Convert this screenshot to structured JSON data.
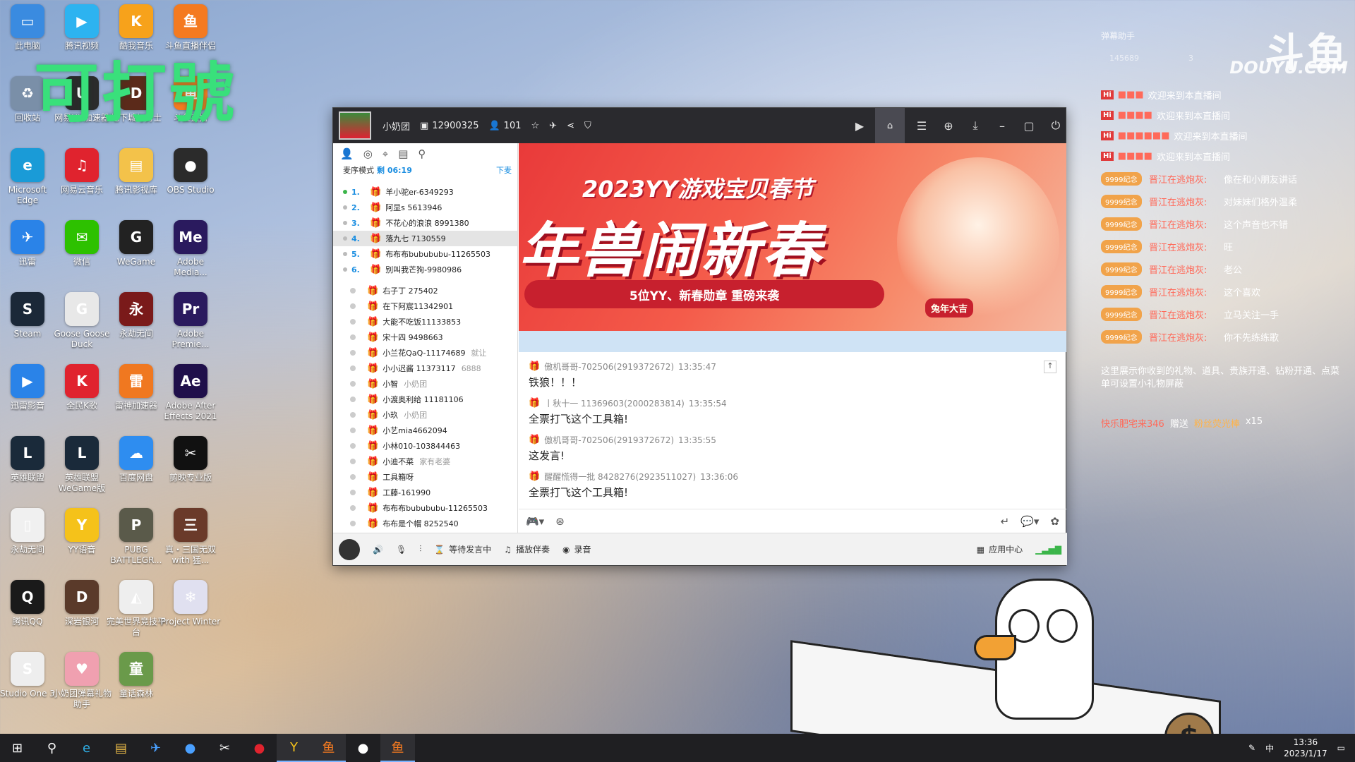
{
  "desktop": {
    "watermark": "可打號",
    "icons": [
      {
        "label": "此电脑",
        "icon": "pc-icon",
        "color": "#3a8be0",
        "char": "▭"
      },
      {
        "label": "腾讯视频",
        "icon": "video-icon",
        "color": "#2db3f0",
        "char": "▶"
      },
      {
        "label": "酷我音乐",
        "icon": "music-icon",
        "color": "#f7a21b",
        "char": "K"
      },
      {
        "label": "斗鱼直播伴侣",
        "icon": "douyu-icon",
        "color": "#f47a20",
        "char": "鱼"
      },
      {
        "label": "回收站",
        "icon": "recycle-bin-icon",
        "color": "#7a8fa8",
        "char": "♻"
      },
      {
        "label": "网易UU加速器",
        "icon": "uu-icon",
        "color": "#2b2b2b",
        "char": "U"
      },
      {
        "label": "地下城与勇士",
        "icon": "dnf-icon",
        "color": "#5b2a1a",
        "char": "D"
      },
      {
        "label": "斗鱼直播",
        "icon": "douyu-live-icon",
        "color": "#f47a20",
        "char": "鱼"
      },
      {
        "label": "Microsoft Edge",
        "icon": "edge-icon",
        "color": "#1a9bd7",
        "char": "e"
      },
      {
        "label": "网易云音乐",
        "icon": "netease-music-icon",
        "color": "#e0232e",
        "char": "♫"
      },
      {
        "label": "腾讯影视库",
        "icon": "folder-icon",
        "color": "#f3c24a",
        "char": "▤"
      },
      {
        "label": "OBS Studio",
        "icon": "obs-icon",
        "color": "#2b2b2b",
        "char": "●"
      },
      {
        "label": "迅雷",
        "icon": "thunder-icon",
        "color": "#2a83e8",
        "char": "✈"
      },
      {
        "label": "微信",
        "icon": "wechat-icon",
        "color": "#2dc100",
        "char": "✉"
      },
      {
        "label": "WeGame",
        "icon": "wegame-icon",
        "color": "#222",
        "char": "G"
      },
      {
        "label": "Adobe Media...",
        "icon": "adobe-me-icon",
        "color": "#2a1a5e",
        "char": "Me"
      },
      {
        "label": "Steam",
        "icon": "steam-icon",
        "color": "#1b2838",
        "char": "S"
      },
      {
        "label": "Goose Goose Duck",
        "icon": "goose-icon",
        "color": "#e8e8e8",
        "char": "G"
      },
      {
        "label": "永劫无间",
        "icon": "naraka-icon",
        "color": "#7a1a1a",
        "char": "永"
      },
      {
        "label": "Adobe Premie...",
        "icon": "adobe-pr-icon",
        "color": "#2a1a5e",
        "char": "Pr"
      },
      {
        "label": "迅雷影音",
        "icon": "xunlei-player-icon",
        "color": "#2a83e8",
        "char": "▶"
      },
      {
        "label": "全民K歌",
        "icon": "kge-icon",
        "color": "#e0232e",
        "char": "K"
      },
      {
        "label": "雷神加速器",
        "icon": "leishen-icon",
        "color": "#f07820",
        "char": "雷"
      },
      {
        "label": "Adobe After Effects 2021",
        "icon": "adobe-ae-icon",
        "color": "#1f0f4a",
        "char": "Ae"
      },
      {
        "label": "英雄联盟",
        "icon": "lol-icon",
        "color": "#1a2a3a",
        "char": "L"
      },
      {
        "label": "英雄联盟WeGame版",
        "icon": "lol-wegame-icon",
        "color": "#1a2a3a",
        "char": "L"
      },
      {
        "label": "百度网盘",
        "icon": "baidu-pan-icon",
        "color": "#2e8df0",
        "char": "☁"
      },
      {
        "label": "剪映专业版",
        "icon": "jianying-icon",
        "color": "#111",
        "char": "✂"
      },
      {
        "label": "永劫无间",
        "icon": "file-icon",
        "color": "#f0f0f0",
        "char": "▯"
      },
      {
        "label": "YY语音",
        "icon": "yy-icon",
        "color": "#f5c21a",
        "char": "Y"
      },
      {
        "label": "PUBG BATTLEGR...",
        "icon": "pubg-icon",
        "color": "#5a5a4a",
        "char": "P"
      },
      {
        "label": "真・三国无双 with 猛...",
        "icon": "sanguo-icon",
        "color": "#6a3a2a",
        "char": "三"
      },
      {
        "label": "腾讯QQ",
        "icon": "qq-icon",
        "color": "#1a1a1a",
        "char": "Q"
      },
      {
        "label": "深岩银河",
        "icon": "deep-rock-icon",
        "color": "#5a3a2a",
        "char": "D"
      },
      {
        "label": "完美世界竞技平台",
        "icon": "perfect-world-icon",
        "color": "#eee",
        "char": "◭"
      },
      {
        "label": "Project Winter",
        "icon": "project-winter-icon",
        "color": "#e0e0f0",
        "char": "❄"
      },
      {
        "label": "Studio One 3",
        "icon": "studio-one-icon",
        "color": "#eee",
        "char": "S"
      },
      {
        "label": "小奶团弹幕礼物助手",
        "icon": "danmu-helper-icon",
        "color": "#f0a0b0",
        "char": "♥"
      },
      {
        "label": "童话森林",
        "icon": "forest-icon",
        "color": "#6a9a4a",
        "char": "童"
      }
    ]
  },
  "window": {
    "channel_name": "小奶团",
    "room_id": "12900325",
    "viewers": "101",
    "left": {
      "mode_label": "麦序模式",
      "time_left": "剩 06:19",
      "down_label": "下麦",
      "queue": [
        {
          "num": "1.",
          "name": "羊小驼er-6349293",
          "active": true
        },
        {
          "num": "2.",
          "name": "阿显s 5613946",
          "active": false
        },
        {
          "num": "3.",
          "name": "不花心的浪浪 8991380",
          "active": false
        },
        {
          "num": "4.",
          "name": "落九七 7130559",
          "active": false
        },
        {
          "num": "5.",
          "name": "布布布bubububu-11265503",
          "active": false
        },
        {
          "num": "6.",
          "name": "别叫我芒狗-9980986",
          "active": false
        }
      ],
      "users": [
        {
          "name": "右子丁 275402",
          "extra": ""
        },
        {
          "name": "在下阿宸11342901",
          "extra": ""
        },
        {
          "name": "大能不吃饭11133853",
          "extra": ""
        },
        {
          "name": "宋十四 9498663",
          "extra": ""
        },
        {
          "name": "小兰花QaQ-11174689",
          "extra": "就让"
        },
        {
          "name": "小小迟酱 11373117",
          "extra": "6888"
        },
        {
          "name": "小智",
          "extra": "小奶团"
        },
        {
          "name": "小渡奥利给 11181106",
          "extra": ""
        },
        {
          "name": "小玖",
          "extra": "小奶团"
        },
        {
          "name": "小艺mia4662094",
          "extra": ""
        },
        {
          "name": "小林010-103844463",
          "extra": ""
        },
        {
          "name": "小迪不菜",
          "extra": "家有老婆"
        },
        {
          "name": "工具箱呀",
          "extra": ""
        },
        {
          "name": "工藤-161990",
          "extra": ""
        },
        {
          "name": "布布布bubububu-11265503",
          "extra": ""
        },
        {
          "name": "布布是个帽 8252540",
          "extra": ""
        }
      ]
    },
    "banner": {
      "title": "2023YY游戏宝贝春节",
      "headline": "年兽闹新春",
      "subtitle": "5位YY、新春勋章 重磅来袭",
      "stamp": "兔年大吉"
    },
    "chat": [
      {
        "user": "傲机哥哥-702506(2919372672)",
        "time": "13:35:47",
        "text": "铁狼！！！"
      },
      {
        "user": "丨秋十一 11369603(2000283814)",
        "time": "13:35:54",
        "text": "全票打飞这个工具箱!"
      },
      {
        "user": "傲机哥哥-702506(2919372672)",
        "time": "13:35:55",
        "text": "这发言!"
      },
      {
        "user": "醒醒慌得一批 8428276(2923511027)",
        "time": "13:36:06",
        "text": "全票打飞这个工具箱!"
      }
    ],
    "bottom": {
      "wait_label": "等待发言中",
      "music_label": "播放伴奏",
      "record_label": "录音",
      "apps_label": "应用中心"
    }
  },
  "overlay": {
    "title": "弹幕助手",
    "logo": "斗鱼",
    "logo_en": "DOUYU.COM",
    "stat1": "145689",
    "stat2": "3",
    "welcomes": [
      {
        "name": "■■■",
        "text": "欢迎来到本直播间"
      },
      {
        "name": "■■■■",
        "text": "欢迎来到本直播间"
      },
      {
        "name": "■■■■■■",
        "text": "欢迎来到本直播间"
      },
      {
        "name": "■■■■",
        "text": "欢迎来到本直播间"
      }
    ],
    "fan_badge": "9999纪念",
    "danmu": [
      {
        "name": "晋江在逃炮灰:",
        "text": "像在和小朋友讲话"
      },
      {
        "name": "晋江在逃炮灰:",
        "text": "对妹妹们格外温柔"
      },
      {
        "name": "晋江在逃炮灰:",
        "text": "这个声音也不错"
      },
      {
        "name": "晋江在逃炮灰:",
        "text": "旺"
      },
      {
        "name": "晋江在逃炮灰:",
        "text": "老公"
      },
      {
        "name": "晋江在逃炮灰:",
        "text": "这个喜欢"
      },
      {
        "name": "晋江在逃炮灰:",
        "text": "立马关注一手"
      },
      {
        "name": "晋江在逃炮灰:",
        "text": "你不先练练歌"
      }
    ],
    "gift_info": "这里展示你收到的礼物、道具、贵族开通、钻粉开通、点菜单可设置小礼物屏蔽",
    "gift_sender": "快乐肥宅来346",
    "gift_verb": "赠送",
    "gift_name": "粉丝荧光棒",
    "gift_count": "x15"
  },
  "taskbar": {
    "time": "13:36",
    "date": "2023/1/17",
    "ime": "中"
  }
}
